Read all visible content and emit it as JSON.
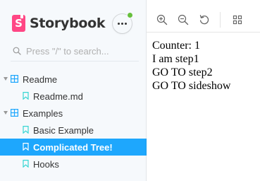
{
  "brand": {
    "name": "Storybook",
    "logo_letter": "S",
    "color": "#ff4785"
  },
  "menu": {
    "icon": "ellipsis-icon",
    "has_update_badge": true,
    "badge_color": "#66bf3c"
  },
  "search": {
    "placeholder": "Press \"/\" to search..."
  },
  "tree": {
    "groups": [
      {
        "label": "Readme",
        "expanded": true,
        "items": [
          {
            "label": "Readme.md",
            "selected": false
          }
        ]
      },
      {
        "label": "Examples",
        "expanded": true,
        "items": [
          {
            "label": "Basic Example",
            "selected": false
          },
          {
            "label": "Complicated Tree!",
            "selected": true
          },
          {
            "label": "Hooks",
            "selected": false
          }
        ]
      }
    ],
    "selected_color": "#1ea7fd"
  },
  "toolbar": {
    "icons": [
      "zoom-in-icon",
      "zoom-out-icon",
      "reset-zoom-icon",
      "grid-icon"
    ]
  },
  "preview": {
    "lines": [
      "Counter: 1",
      "I am step1",
      "GO TO step2",
      "GO TO sideshow"
    ]
  }
}
